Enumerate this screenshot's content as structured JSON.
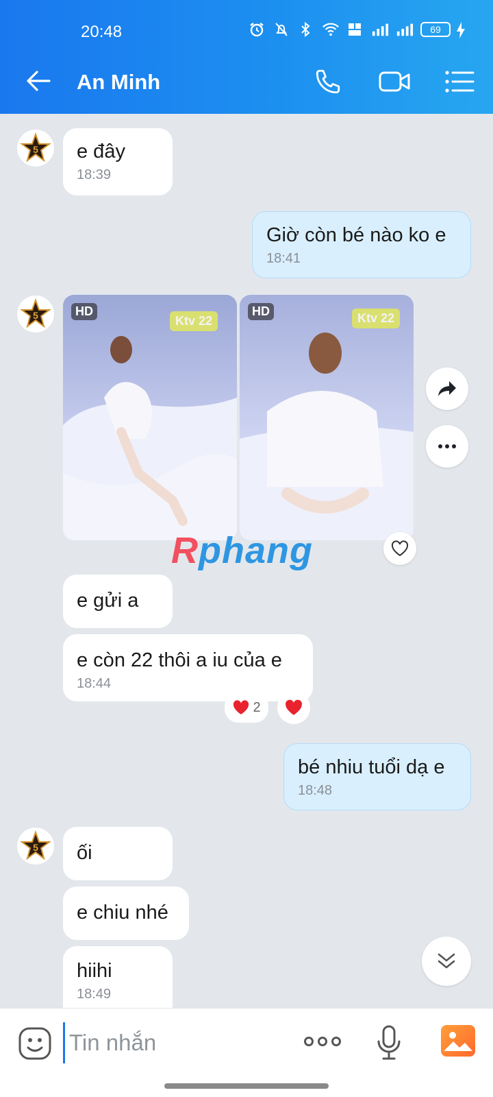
{
  "status_bar": {
    "time": "20:48",
    "battery": "69"
  },
  "header": {
    "contact_name": "An Minh"
  },
  "messages": [
    {
      "text": "e đây",
      "time": "18:39"
    },
    {
      "text": "Giờ còn bé nào ko e",
      "time": "18:41"
    },
    {
      "text": "e gửi a"
    },
    {
      "text": "e còn 22 thôi a iu của e",
      "time": "18:44",
      "reaction_count": "2"
    },
    {
      "text": "bé nhiu tuổi dạ e",
      "time": "18:48"
    },
    {
      "text": "ối"
    },
    {
      "text": "e chiu nhé"
    },
    {
      "text": "hiihi",
      "time": "18:49"
    }
  ],
  "images": [
    {
      "badge": "HD",
      "tag": "Ktv 22"
    },
    {
      "badge": "HD",
      "tag": "Ktv 22"
    }
  ],
  "watermark": {
    "part1": "R",
    "part2": "phang"
  },
  "composer": {
    "placeholder": "Tin nhắn"
  },
  "colors": {
    "accent": "#1a78ee",
    "outgoing_bubble": "#d9effe",
    "background": "#e3e7ec"
  }
}
